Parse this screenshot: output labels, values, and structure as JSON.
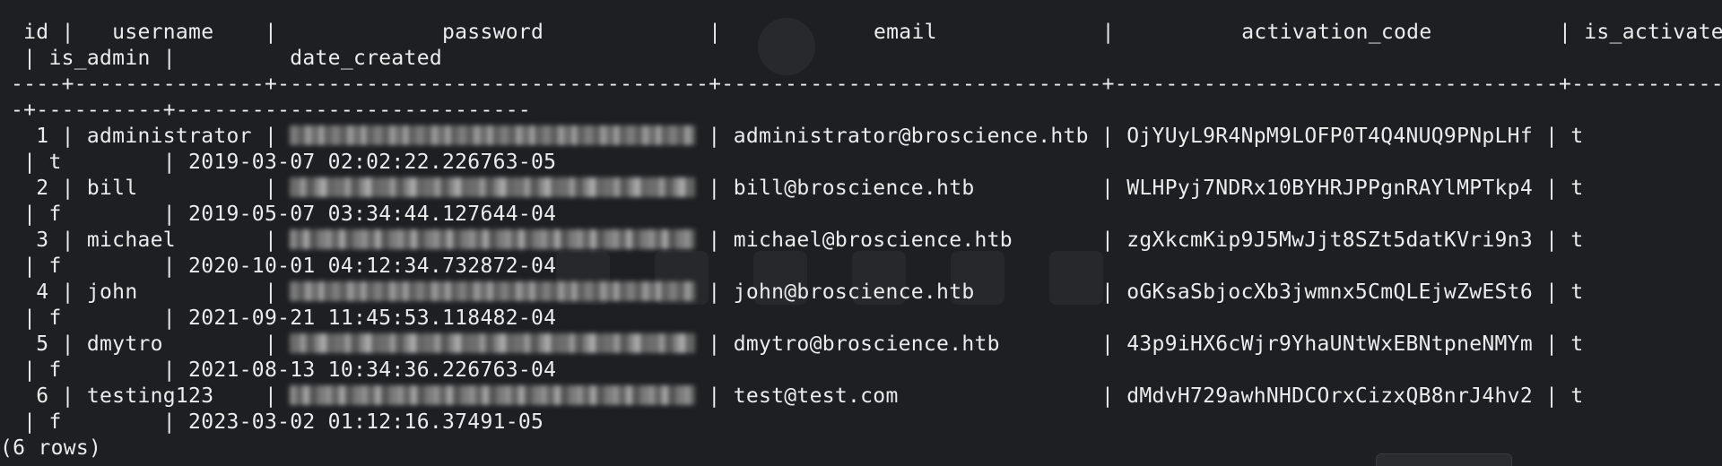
{
  "terminal": {
    "header": {
      "line1": " id |   username    |             password             |            email             |          activation_code          | is_activated",
      "line2": " | is_admin |         date_created"
    },
    "separator": {
      "line1": "----+---------------+----------------------------------+------------------------------+-----------------------------------+-------------",
      "line2": "-+----------+----------------------------"
    },
    "rows": [
      {
        "prefix": "  1 | administrator | ",
        "suffix": " | administrator@broscience.htb | OjYUyL9R4NpM9LOFP0T4Q4NUQ9PNpLHf | t",
        "line2": " | t        | 2019-03-07 02:02:22.226763-05"
      },
      {
        "prefix": "  2 | bill          | ",
        "suffix": " | bill@broscience.htb          | WLHPyj7NDRx10BYHRJPPgnRAYlMPTkp4 | t",
        "line2": " | f        | 2019-05-07 03:34:44.127644-04"
      },
      {
        "prefix": "  3 | michael       | ",
        "suffix": " | michael@broscience.htb       | zgXkcmKip9J5MwJjt8SZt5datKVri9n3 | t",
        "line2": " | f        | 2020-10-01 04:12:34.732872-04"
      },
      {
        "prefix": "  4 | john          | ",
        "suffix": " | john@broscience.htb          | oGKsaSbjocXb3jwmnx5CmQLEjwZwESt6 | t",
        "line2": " | f        | 2021-09-21 11:45:53.118482-04"
      },
      {
        "prefix": "  5 | dmytro        | ",
        "suffix": " | dmytro@broscience.htb        | 43p9iHX6cWjr9YhaUNtWxEBNtpneNMYm | t",
        "line2": " | f        | 2021-08-13 10:34:36.226763-04"
      },
      {
        "prefix": "  6 | testing123    | ",
        "suffix": " | test@test.com                | dMdvH729awhNHDCOrxCizxQB8nrJ4hv2 | t",
        "line2": " | f        | 2023-03-02 01:12:16.37491-05"
      }
    ],
    "footer": "(6 rows)"
  },
  "colors": {
    "background": "#1e1f22",
    "text": "#ececec"
  },
  "icons": {
    "password_cell": "redacted-blur"
  }
}
